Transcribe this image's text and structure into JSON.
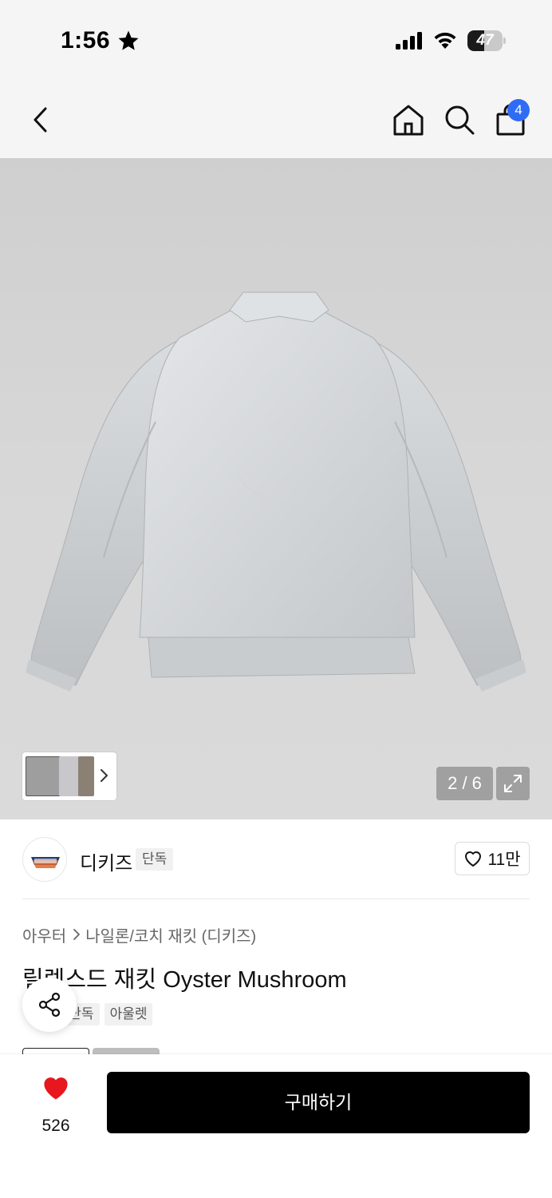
{
  "status_bar": {
    "time": "1:56",
    "battery_level": "47",
    "battery_fraction": 0.47,
    "icons": [
      "star-icon",
      "signal-icon",
      "wifi-icon",
      "battery-icon"
    ]
  },
  "nav": {
    "back_icon": "chevron-left-icon",
    "home_icon": "home-icon",
    "search_icon": "search-icon",
    "cart_icon": "shopping-bag-icon",
    "cart_count": "4",
    "badge_color": "#2f6cf5"
  },
  "gallery": {
    "page_indicator": "2 / 6",
    "current_page": 2,
    "total_pages": 6,
    "thumbnails_chevron": "chevron-right-icon",
    "expand_icon": "expand-icon"
  },
  "brand": {
    "name": "디키즈",
    "badge": "단독",
    "like_count": "11만",
    "like_icon": "heart-outline-icon"
  },
  "product": {
    "breadcrumb": [
      "아우터",
      "나일론/코치 재킷 (디키즈)"
    ],
    "title": "릴렉스드 재킷 Oyster Mushroom",
    "tags": [
      "단독",
      "아울렛"
    ],
    "share_icon": "share-icon"
  },
  "bottom_bar": {
    "wish_count": "526",
    "wish_icon": "heart-filled-icon",
    "wish_color": "#e8161e",
    "buy_label": "구매하기",
    "buy_color": "#000000"
  }
}
